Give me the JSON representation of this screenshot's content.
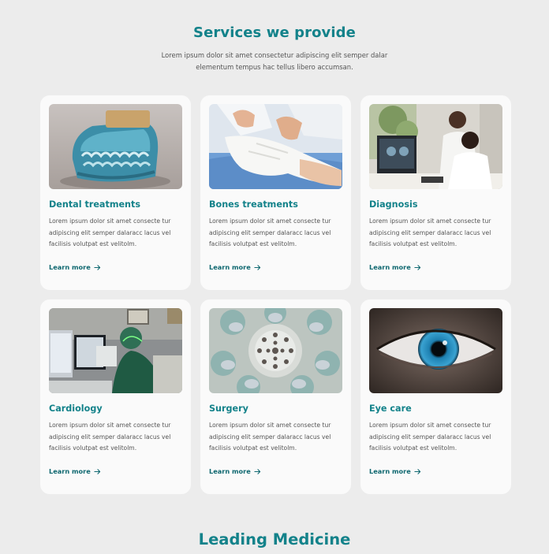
{
  "header": {
    "title": "Services we provide",
    "subtitle_line1": "Lorem ipsum dolor sit amet consectetur adipiscing elit semper dalar",
    "subtitle_line2": "elementum tempus hac tellus libero accumsan."
  },
  "services": [
    {
      "title": "Dental treatments",
      "text": "Lorem ipsum dolor sit amet consecte tur adipiscing elit semper dalaracc lacus vel facilisis volutpat est velitolm.",
      "link": "Learn more",
      "image": "dental-model-image"
    },
    {
      "title": "Bones treatments",
      "text": "Lorem ipsum dolor sit amet consecte tur adipiscing elit semper dalaracc lacus vel facilisis volutpat est velitolm.",
      "link": "Learn more",
      "image": "bandaged-leg-image"
    },
    {
      "title": "Diagnosis",
      "text": "Lorem ipsum dolor sit amet consecte tur adipiscing elit semper dalaracc lacus vel facilisis volutpat est velitolm.",
      "link": "Learn more",
      "image": "doctors-monitor-image"
    },
    {
      "title": "Cardiology",
      "text": "Lorem ipsum dolor sit amet consecte tur adipiscing elit semper dalaracc lacus vel facilisis volutpat est velitolm.",
      "link": "Learn more",
      "image": "cardiology-monitors-image"
    },
    {
      "title": "Surgery",
      "text": "Lorem ipsum dolor sit amet consecte tur adipiscing elit semper dalaracc lacus vel facilisis volutpat est velitolm.",
      "link": "Learn more",
      "image": "surgeons-overhead-image"
    },
    {
      "title": "Eye care",
      "text": "Lorem ipsum dolor sit amet consecte tur adipiscing elit semper dalaracc lacus vel facilisis volutpat est velitolm.",
      "link": "Learn more",
      "image": "eye-closeup-image"
    }
  ],
  "next_section": {
    "title": "Leading Medicine"
  },
  "colors": {
    "accent": "#13828a",
    "link": "#0f6870",
    "background": "#ececec",
    "card": "#fafafa"
  }
}
